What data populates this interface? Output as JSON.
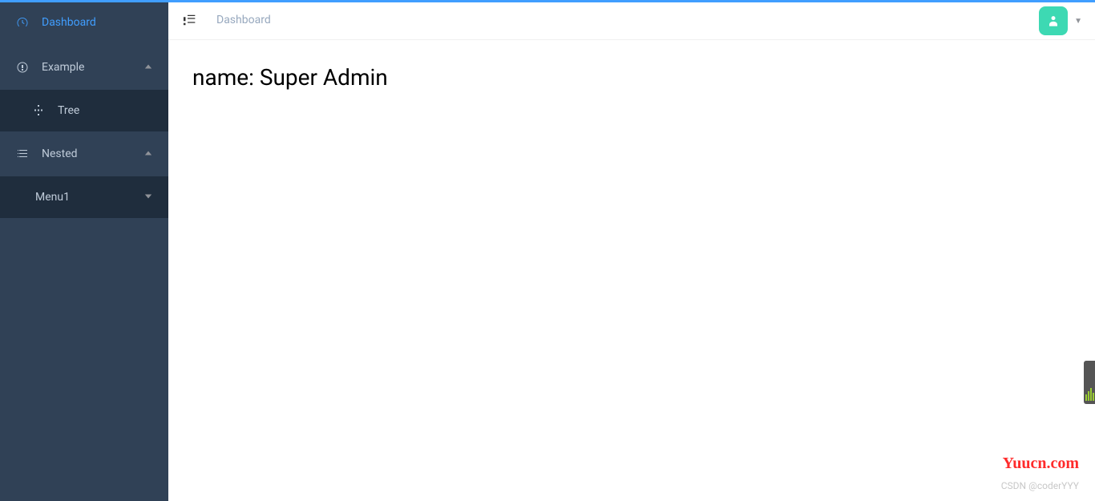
{
  "sidebar": {
    "items": [
      {
        "label": "Dashboard",
        "icon": "dashboard-icon",
        "active": true
      },
      {
        "label": "Example",
        "icon": "example-icon",
        "expandable": true,
        "children": [
          {
            "label": "Tree",
            "icon": "tree-icon"
          }
        ]
      },
      {
        "label": "Nested",
        "icon": "nested-icon",
        "expandable": true,
        "children": [
          {
            "label": "Menu1",
            "expandable": true
          }
        ]
      }
    ]
  },
  "header": {
    "breadcrumb": "Dashboard"
  },
  "main": {
    "content_text": "name: Super Admin"
  },
  "watermark": {
    "brand": "Yuucn.com",
    "credit": "CSDN @coderYYY"
  }
}
